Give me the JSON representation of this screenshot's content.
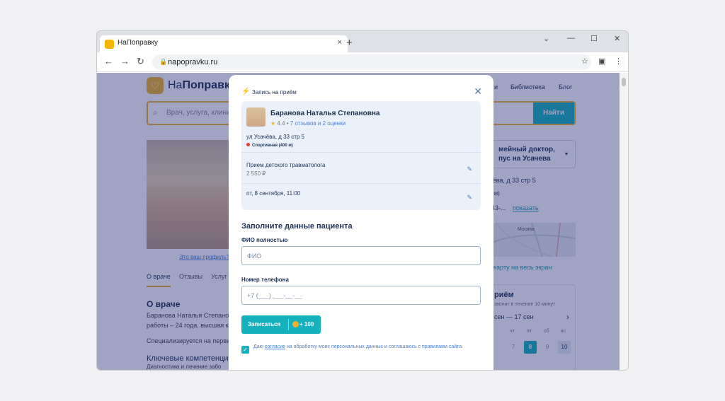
{
  "browser": {
    "tab_title": "НаПоправку",
    "tab_close": "×",
    "new_tab": "+",
    "url": "napopravku.ru",
    "controls": {
      "chevron": "⌄",
      "minimize": "—",
      "maximize": "☐",
      "close": "✕"
    },
    "icons": {
      "back": "←",
      "forward": "→",
      "reload": "↻",
      "lock": "🔒",
      "star": "☆",
      "sidebar": "▣",
      "menu": "⋮"
    }
  },
  "site": {
    "logo_prefix": "На",
    "logo_bold": "Поправку",
    "nav": [
      "и",
      "Библиотека",
      "Блог"
    ],
    "search_placeholder": "Врач, услуга, клини",
    "search_button": "Найти"
  },
  "profile": {
    "profile_link": "Это ваш профиль?",
    "tabs": [
      "О враче",
      "Отзывы",
      "Услуг"
    ],
    "about_title": "О враче",
    "about_text": [
      "Баранова Наталья Степанов",
      "работы – 24 года, высшая ка",
      "",
      "Специализируется на перви"
    ],
    "key_comp_title": "Ключевые компетенци",
    "key_comp_text": "Диагностика и лечение забо"
  },
  "right_panel": {
    "clinic_line1": "мейный доктор,",
    "clinic_line2": "пус на Усачева",
    "caret": "▾",
    "address": "чёва, д 33 стр 5",
    "metro": "0 м)",
    "phone_partial": "-43-...",
    "show_link": "показать",
    "map_label": "Москва",
    "map_link": "карту на весь экран",
    "booking_title": "риём",
    "booking_sub": "звонит в течение 10 минут",
    "date_range": "сен — 17 сен",
    "next_arrow": "›",
    "days_of_week": [
      "чт",
      "пт",
      "сб",
      "вс"
    ],
    "days": [
      "7",
      "8",
      "9",
      "10"
    ]
  },
  "modal": {
    "header": "Запись на приём",
    "close": "✕",
    "doctor_name": "Баранова Наталья Степановна",
    "rating": "4.4",
    "rating_sep": " •",
    "reviews": "7 отзывов и 2 оценки",
    "address": "ул Усачёва, д 33 стр 5",
    "metro": "Спортивная (400 м)",
    "service": "Прием детского травматолога",
    "price": "2 550 ₽",
    "datetime": "пт, 8 сентября, 11:00",
    "edit_icon": "✎",
    "form_title": "Заполните данные пациента",
    "fio_label": "ФИО полностью",
    "fio_placeholder": "ФИО",
    "phone_label": "Номер телефона",
    "phone_placeholder": "+7 (___) ___-__-__",
    "submit_label": "Записаться",
    "bonus": "+ 100",
    "consent_prefix": "Даю ",
    "consent_link": "согласие",
    "consent_rest": " на обработку моих персональных данных и соглашаюсь с правилами сайта",
    "checkbox": "✓"
  },
  "colors": {
    "accent": "#15b1bd",
    "brand": "#f2b12c",
    "overlay": "#1c266e"
  }
}
